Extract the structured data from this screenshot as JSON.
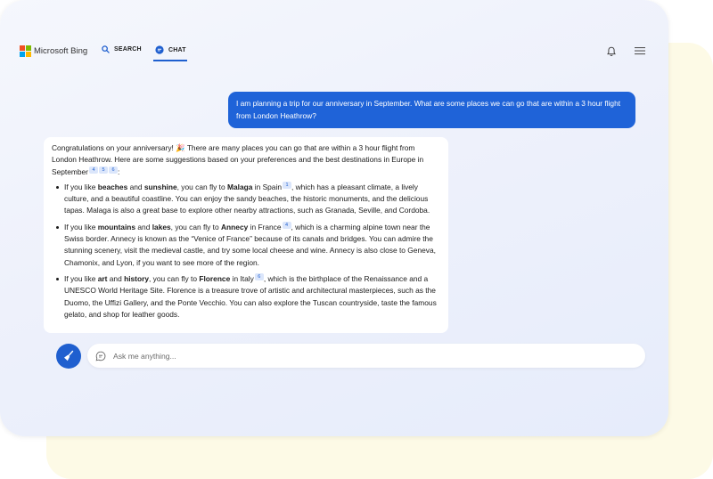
{
  "colors": {
    "accent": "#1f5fcf",
    "user_bubble": "#1f63d8",
    "backdrop_card": "#fdfae6",
    "logo": [
      "#f25022",
      "#7fba00",
      "#00a4ef",
      "#ffb900"
    ]
  },
  "header": {
    "brand": "Microsoft Bing",
    "brand_icon": "microsoft-logo-icon",
    "tabs": [
      {
        "label": "SEARCH",
        "icon": "search-icon"
      },
      {
        "label": "CHAT",
        "icon": "chat-icon",
        "active": true
      }
    ],
    "right_icons": [
      "bell-icon",
      "hamburger-menu-icon"
    ]
  },
  "conversation": {
    "user_message": "I am planning a trip for our anniversary in September. What are some places we can go that are within a 3 hour flight from London Heathrow?",
    "bot": {
      "intro": {
        "text_before_emoji": "Congratulations on your anniversary! ",
        "emoji": "🎉",
        "text_after_emoji": " There are many places you can go that are within a 3 hour flight from London Heathrow. Here are some suggestions based on your preferences and the best destinations in Europe in September",
        "citations": [
          "4",
          "5",
          "6"
        ],
        "end": ":"
      },
      "items": [
        {
          "p1": "If you like ",
          "k1": "beaches",
          "p2": " and ",
          "k2": "sunshine",
          "p3": ", you can fly to ",
          "dest": "Malaga",
          "p4": " in Spain",
          "cite": "1",
          "rest": ", which has a pleasant climate, a lively culture, and a beautiful coastline. You can enjoy the sandy beaches, the historic monuments, and the delicious tapas. Malaga is also a great base to explore other nearby attractions, such as Granada, Seville, and Cordoba."
        },
        {
          "p1": "If you like ",
          "k1": "mountains",
          "p2": " and ",
          "k2": "lakes",
          "p3": ", you can fly to ",
          "dest": "Annecy",
          "p4": " in France",
          "cite": "4",
          "rest": ", which is a charming alpine town near the Swiss border. Annecy is known as the “Venice of France” because of its canals and bridges. You can admire the stunning scenery, visit the medieval castle, and try some local cheese and wine. Annecy is also close to Geneva, Chamonix, and Lyon, if you want to see more of the region."
        },
        {
          "p1": "If you like ",
          "k1": "art",
          "p2": " and ",
          "k2": "history",
          "p3": ", you can fly to ",
          "dest": "Florence",
          "p4": " in Italy",
          "cite": "6",
          "rest": ", which is the birthplace of the Renaissance and a UNESCO World Heritage Site. Florence is a treasure trove of artistic and architectural masterpieces, such as the Duomo, the Uffizi Gallery, and the Ponte Vecchio. You can also explore the Tuscan countryside, taste the famous gelato, and shop for leather goods."
        }
      ]
    }
  },
  "composer": {
    "new_topic_icon": "broom-icon",
    "input_icon": "chat-bubble-icon",
    "placeholder": "Ask me anything...",
    "value": ""
  }
}
